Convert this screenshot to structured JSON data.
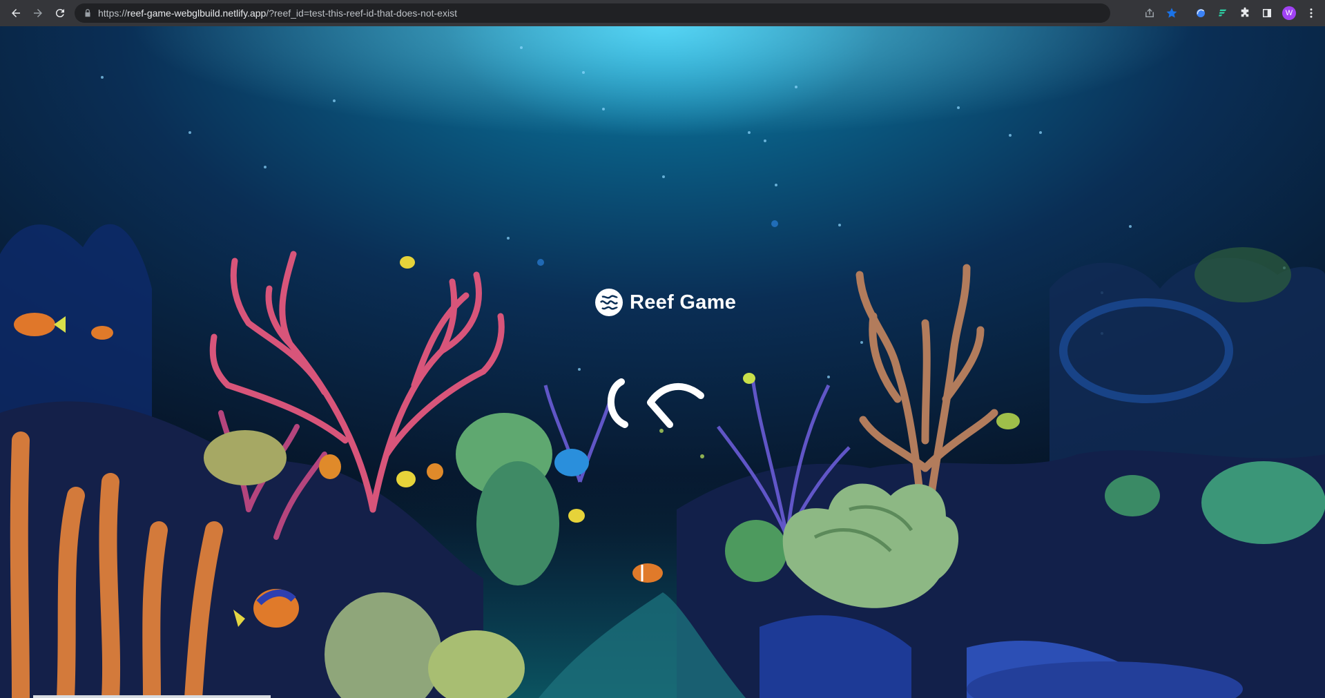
{
  "browser": {
    "url_prefix": "https://",
    "url_host": "reef-game-webglbuild.netlify.app",
    "url_path": "/?reef_id=test-this-reef-id-that-does-not-exist",
    "avatar_letter": "W",
    "icons": [
      "back-arrow-icon",
      "forward-arrow-icon",
      "reload-icon",
      "lock-icon",
      "share-icon",
      "star-icon",
      "extension-icon",
      "puzzle-icon",
      "side-panel-icon",
      "more-icon"
    ]
  },
  "game": {
    "title": "Reef Game",
    "logo_icon": "coral-brain-icon",
    "loading_icon": "loading-spinner-icon"
  },
  "colors": {
    "ocean_top": "#0a5f86",
    "ocean_deep": "#071a33",
    "light_ray": "#22b8e6",
    "accent_blue": "#1a73e8"
  }
}
